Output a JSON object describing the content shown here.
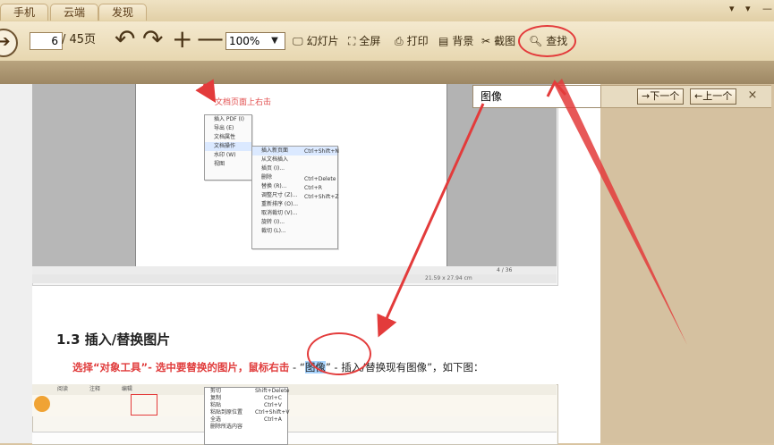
{
  "tabs": [
    "手机",
    "云端",
    "发现"
  ],
  "window_controls": [
    "▾",
    "▾",
    "—"
  ],
  "toolbar": {
    "back_icon": "arrow-right-icon",
    "page_current": "6",
    "page_total": "/ 45页",
    "zoom": "100%",
    "tools": [
      {
        "label": "幻灯片",
        "icon": "slideshow-icon"
      },
      {
        "label": "全屏",
        "icon": "fullscreen-icon"
      },
      {
        "label": "打印",
        "icon": "print-icon"
      },
      {
        "label": "背景",
        "icon": "background-icon"
      },
      {
        "label": "截图",
        "icon": "scissors-icon"
      },
      {
        "label": "查找",
        "icon": "search-icon"
      }
    ]
  },
  "find_bar": {
    "query": "图像",
    "next_label": "→下一个",
    "prev_label": "←上一个",
    "close_label": "×"
  },
  "document": {
    "snapshot_caption": "文档页面上右击",
    "snapshot_menu": [
      "插入 PDF (I)",
      "导出 (E)",
      "文档属性",
      "文档操作",
      "水印 (W)",
      "视图"
    ],
    "snapshot_submenu": [
      "插入新页面",
      "从文档插入",
      "插页 (I)...",
      "删除",
      "替换 (R)...",
      "调整尺寸 (Z)...",
      "重新排序 (O)...",
      "取消裁切 (V)...",
      "旋转 (I)...",
      "裁切 (L)..."
    ],
    "snapshot_shortcuts": [
      "Ctrl+Shift+N",
      "Ctrl+Delete",
      "Ctrl+R",
      "Ctrl+Shift+Z"
    ],
    "snapshot_status": "21.59 x 27.94 cm",
    "snapshot_page": "4 / 36",
    "heading": "1.3 插入/替换图片",
    "instruction_red": "选择“对象工具”- 选中要替换的图片，鼠标右击",
    "instruction_mid": "- “",
    "instruction_highlight": "图像",
    "instruction_tail": "” - 插入/替换现有图像”，如下图：",
    "bottom_menu": [
      "剪切",
      "复制",
      "粘贴",
      "粘贴到原位置",
      "全选",
      "删除所选内容"
    ],
    "bottom_shortcuts": [
      "Shift+Delete",
      "Ctrl+C",
      "Ctrl+V",
      "Ctrl+Shift+V",
      "Ctrl+A"
    ],
    "bottom_tabs": [
      "阅读",
      "注释",
      "编辑"
    ]
  },
  "colors": {
    "accent_red": "#e33b3b",
    "highlight": "#a9d5ff",
    "chrome": "#e7d7b0"
  }
}
